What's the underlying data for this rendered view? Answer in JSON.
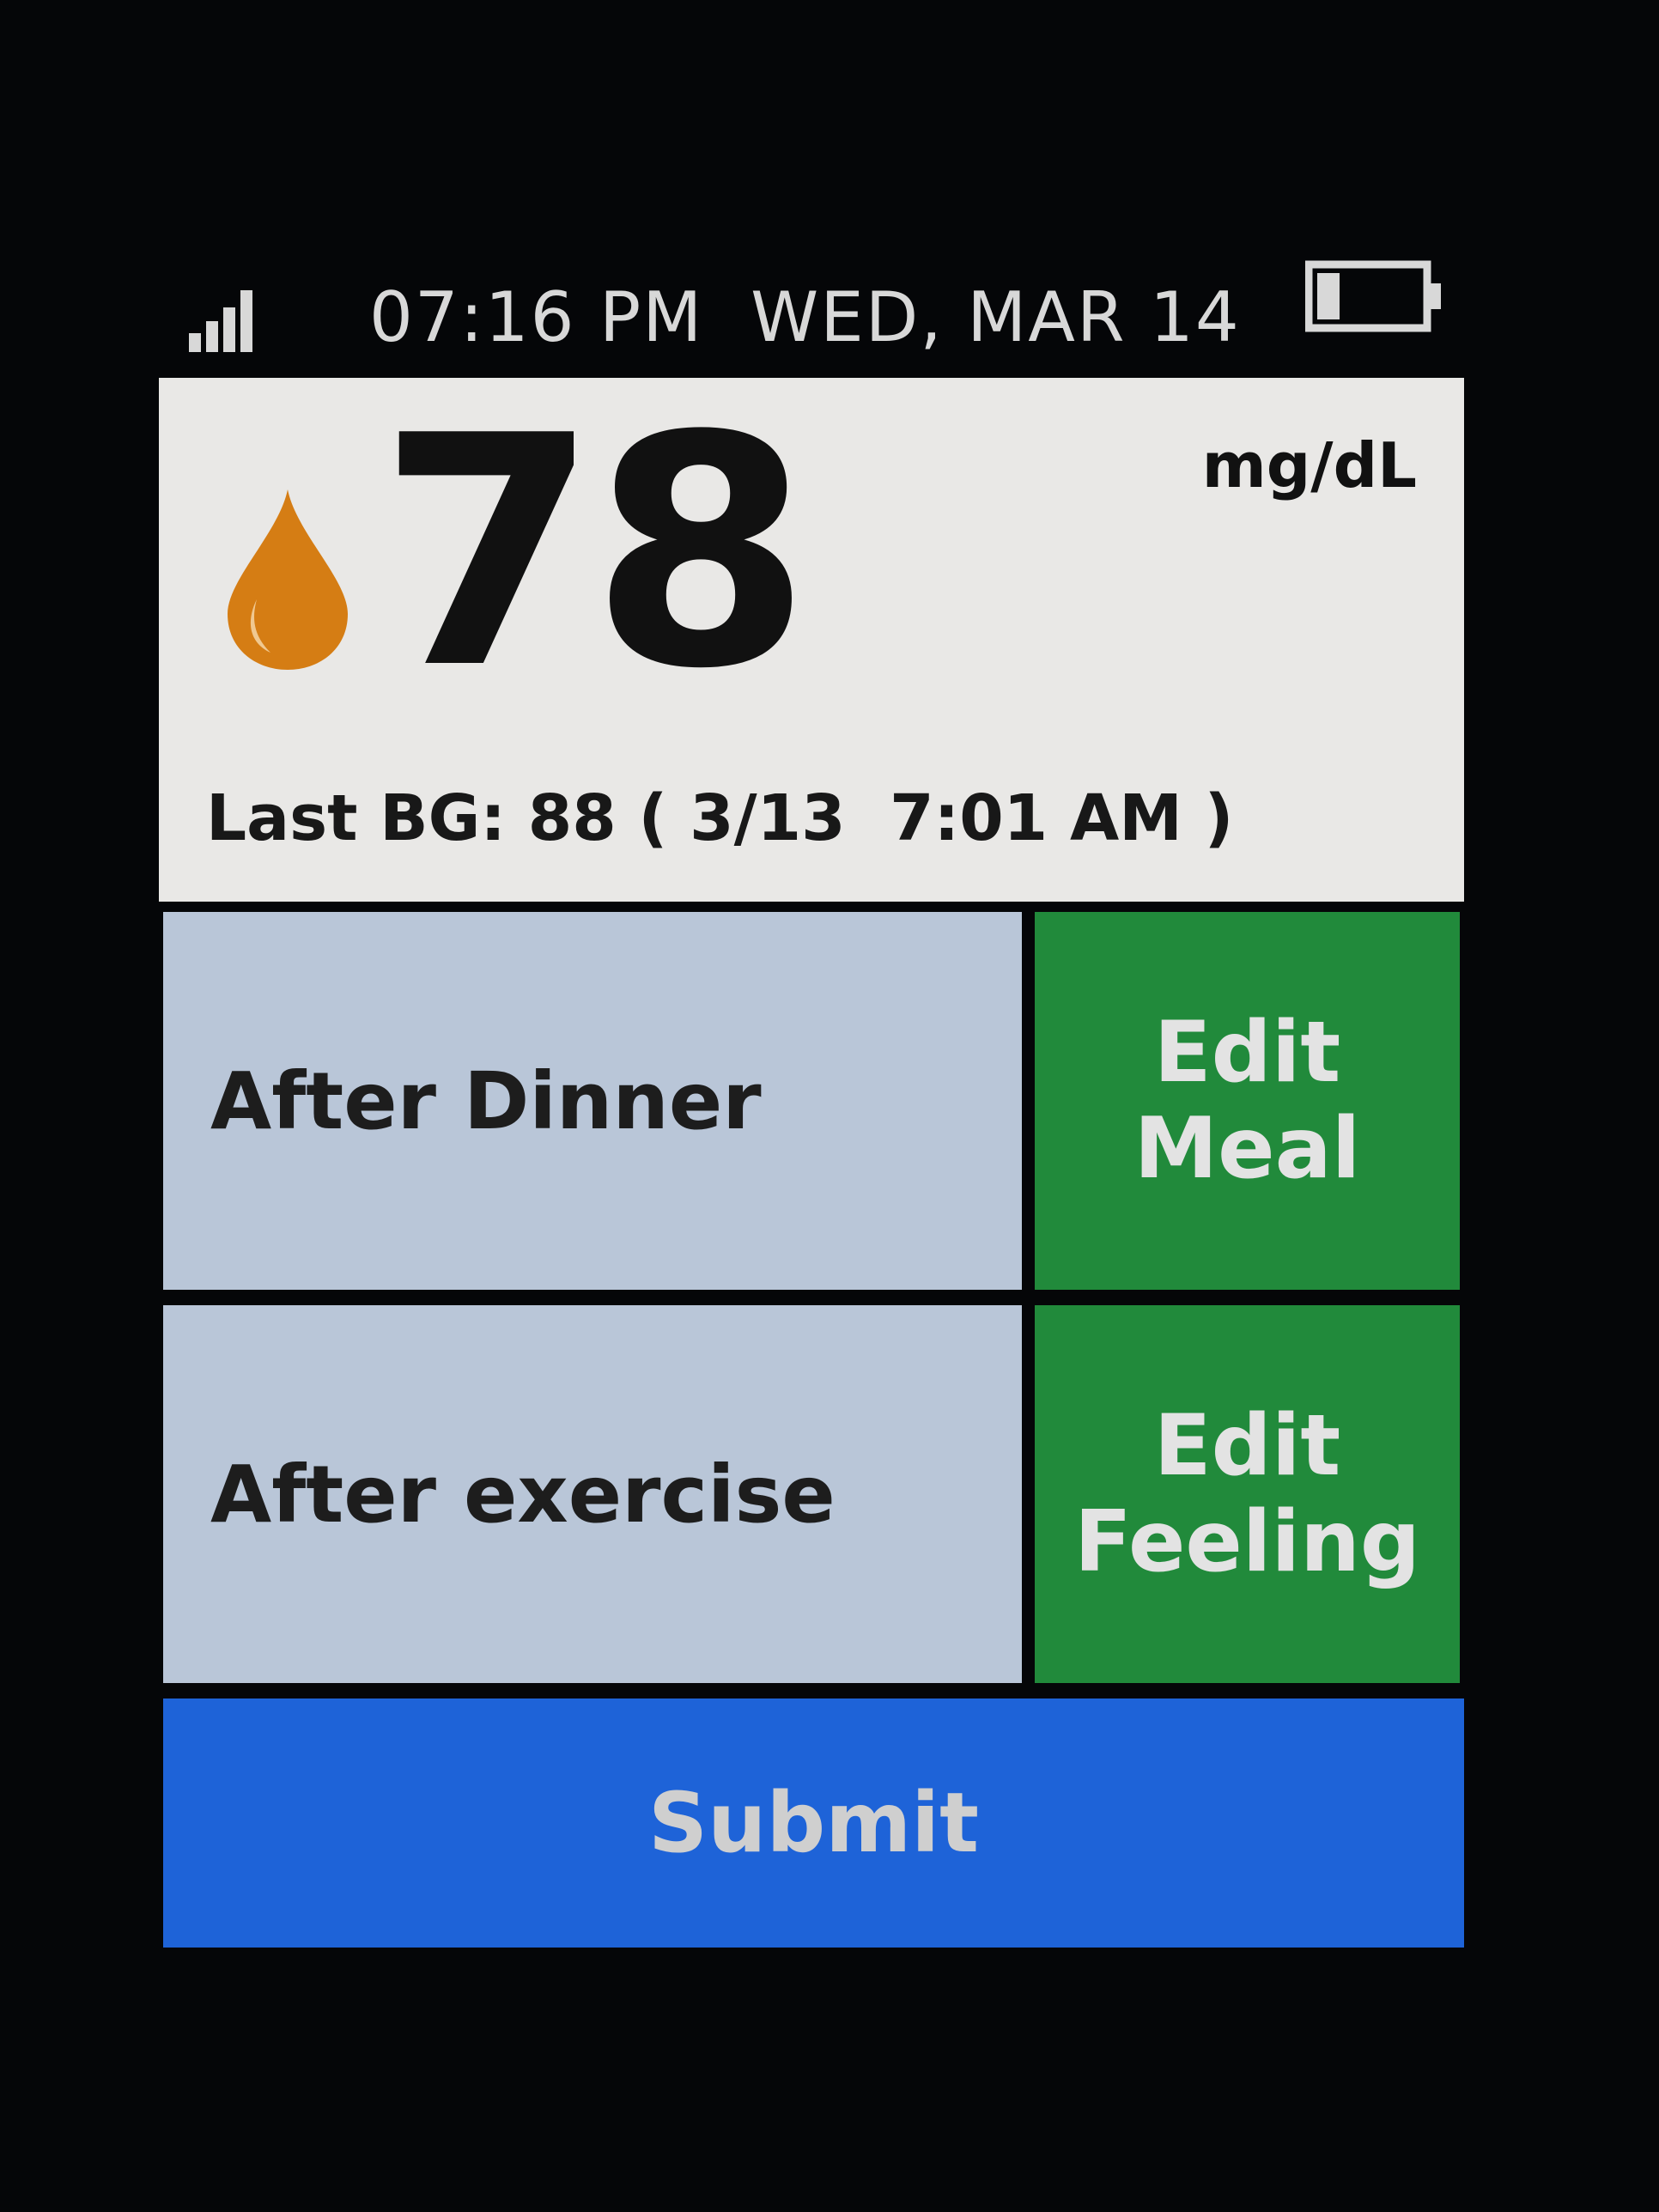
{
  "status_bar": {
    "time": "07:16 PM",
    "date": "WED, MAR 14",
    "signal_icon": "signal-bars-icon",
    "battery_icon": "battery-icon"
  },
  "reading": {
    "value": "78",
    "unit": "mg/dL",
    "icon": "blood-drop-icon",
    "icon_color": "#d57d14",
    "last_bg": "Last BG: 88 ( 3/13  7:01 AM )"
  },
  "rows": {
    "meal": {
      "label": "After Dinner",
      "button_line1": "Edit",
      "button_line2": "Meal"
    },
    "feeling": {
      "label": "After exercise",
      "button_line1": "Edit",
      "button_line2": "Feeling"
    }
  },
  "submit": {
    "label": "Submit"
  },
  "colors": {
    "label_bg": "#b9c6d8",
    "edit_bg": "#218a3b",
    "submit_bg": "#1e63d8",
    "panel_bg": "#e9e8e6"
  }
}
